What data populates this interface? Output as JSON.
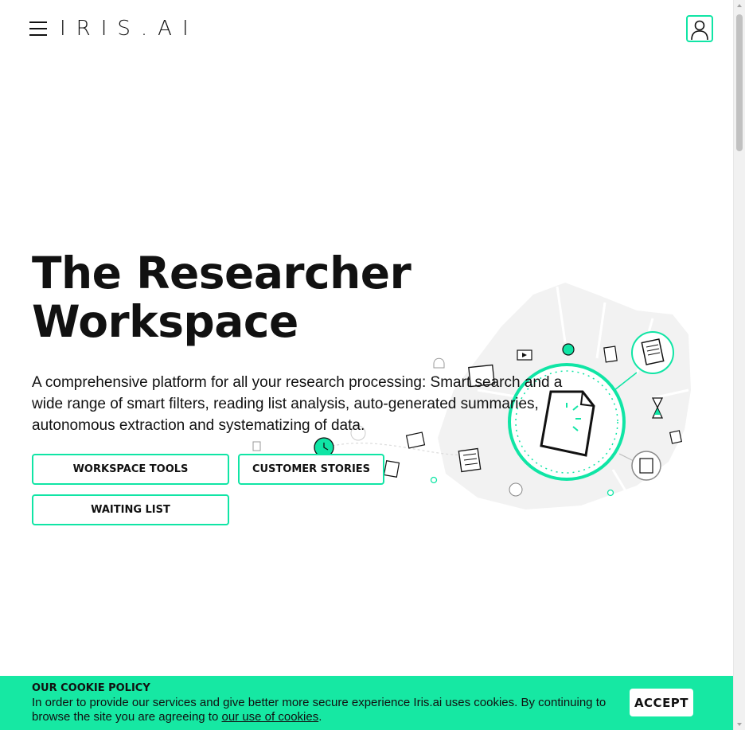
{
  "header": {
    "logo": "IRIS.AI"
  },
  "hero": {
    "title_line1": "The Researcher",
    "title_line2": "Workspace",
    "description": "A comprehensive platform for all your research processing: Smart search and a wide range of smart filters, reading list analysis, auto-generated summaries, autonomous extraction and systematizing of data.",
    "buttons": {
      "workspace_tools": "WORKSPACE TOOLS",
      "customer_stories": "CUSTOMER STORIES",
      "waiting_list": "WAITING LIST"
    }
  },
  "cookie": {
    "title": "OUR COOKIE POLICY",
    "text": "In order to provide our services and give better more secure experience Iris.ai uses cookies. By continuing to browse the site you are agreeing to ",
    "link": "our use of cookies",
    "period": ".",
    "accept": "ACCEPT"
  },
  "colors": {
    "accent": "#10e5a5",
    "cookie_bar": "#16e8a3"
  }
}
